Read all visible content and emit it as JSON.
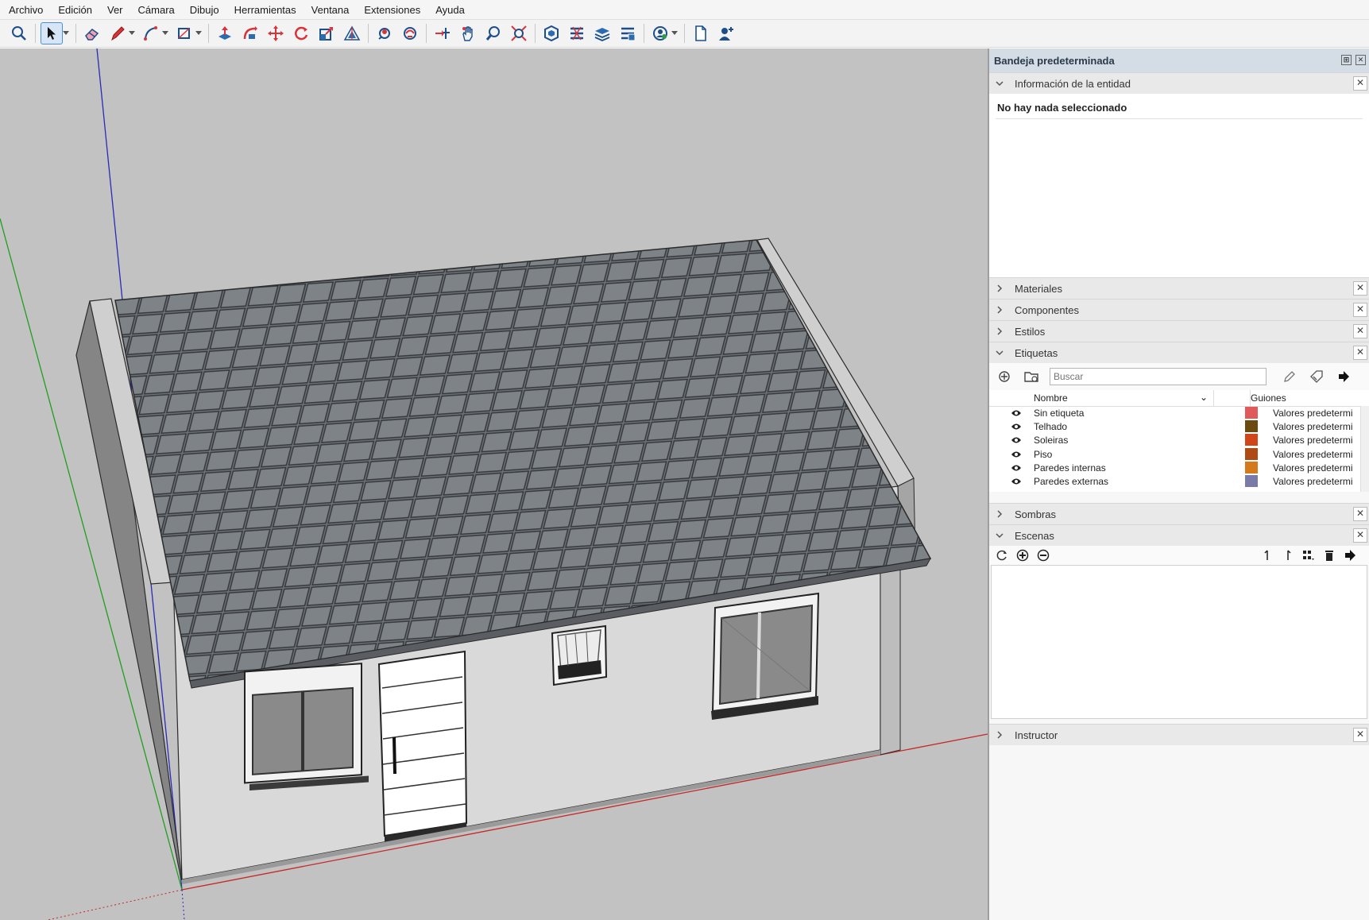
{
  "menu": [
    "Archivo",
    "Edición",
    "Ver",
    "Cámara",
    "Dibujo",
    "Herramientas",
    "Ventana",
    "Extensiones",
    "Ayuda"
  ],
  "toolbar": {
    "tools": [
      "search-icon",
      "select-arrow-icon",
      "eraser-icon",
      "pencil-icon",
      "arc-icon",
      "rectangle-icon",
      "push-pull-icon",
      "follow-me-icon",
      "move-icon",
      "rotate-icon",
      "scale-icon",
      "offset-icon",
      "orbit-icon",
      "pan-icon",
      "zoom-icon",
      "zoom-extents-icon",
      "warehouse-icon",
      "extension-warehouse-icon",
      "layout-icon",
      "styles-icon",
      "account-icon",
      "new-file-icon",
      "add-user-icon"
    ]
  },
  "tray": {
    "title": "Bandeja predeterminada",
    "entity_info": {
      "title": "Información de la entidad",
      "status": "No hay nada seleccionado"
    },
    "collapsed_panels": [
      "Materiales",
      "Componentes",
      "Estilos"
    ],
    "tags": {
      "title": "Etiquetas",
      "search_placeholder": "Buscar",
      "col_name": "Nombre",
      "col_dashes": "Guiones",
      "rows": [
        {
          "name": "Sin etiqueta",
          "color": "#e05a5a",
          "dashes": "Valores predetermi"
        },
        {
          "name": "Telhado",
          "color": "#6b4a10",
          "dashes": "Valores predetermi"
        },
        {
          "name": "Soleiras",
          "color": "#d0461a",
          "dashes": "Valores predetermi"
        },
        {
          "name": "Piso",
          "color": "#b04a14",
          "dashes": "Valores predetermi"
        },
        {
          "name": "Paredes internas",
          "color": "#d47a1a",
          "dashes": "Valores predetermi"
        },
        {
          "name": "Paredes externas",
          "color": "#7a7aa8",
          "dashes": "Valores predetermi"
        }
      ]
    },
    "shadows": {
      "title": "Sombras"
    },
    "scenes": {
      "title": "Escenas"
    },
    "instructor": {
      "title": "Instructor"
    }
  }
}
